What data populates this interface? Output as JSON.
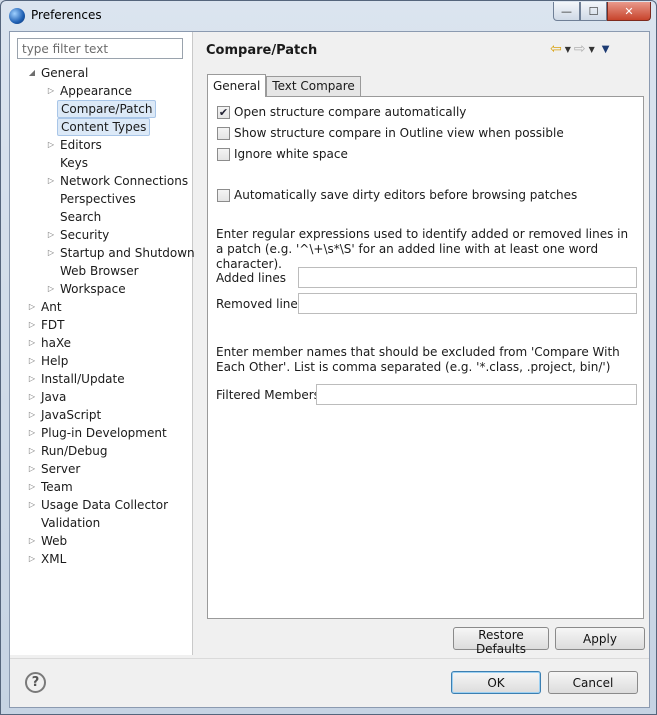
{
  "window": {
    "title": "Preferences"
  },
  "filter": {
    "placeholder": "type filter text"
  },
  "tree": [
    {
      "label": "General",
      "level": 0,
      "expanded": true
    },
    {
      "label": "Appearance",
      "level": 1,
      "expandable": true
    },
    {
      "label": "Compare/Patch",
      "level": 1,
      "selected": true
    },
    {
      "label": "Content Types",
      "level": 1,
      "highlighted": true
    },
    {
      "label": "Editors",
      "level": 1,
      "expandable": true
    },
    {
      "label": "Keys",
      "level": 1
    },
    {
      "label": "Network Connections",
      "level": 1,
      "expandable": true
    },
    {
      "label": "Perspectives",
      "level": 1
    },
    {
      "label": "Search",
      "level": 1
    },
    {
      "label": "Security",
      "level": 1,
      "expandable": true
    },
    {
      "label": "Startup and Shutdown",
      "level": 1,
      "expandable": true
    },
    {
      "label": "Web Browser",
      "level": 1
    },
    {
      "label": "Workspace",
      "level": 1,
      "expandable": true
    },
    {
      "label": "Ant",
      "level": 0,
      "expandable": true
    },
    {
      "label": "FDT",
      "level": 0,
      "expandable": true
    },
    {
      "label": "haXe",
      "level": 0,
      "expandable": true
    },
    {
      "label": "Help",
      "level": 0,
      "expandable": true
    },
    {
      "label": "Install/Update",
      "level": 0,
      "expandable": true
    },
    {
      "label": "Java",
      "level": 0,
      "expandable": true
    },
    {
      "label": "JavaScript",
      "level": 0,
      "expandable": true
    },
    {
      "label": "Plug-in Development",
      "level": 0,
      "expandable": true
    },
    {
      "label": "Run/Debug",
      "level": 0,
      "expandable": true
    },
    {
      "label": "Server",
      "level": 0,
      "expandable": true
    },
    {
      "label": "Team",
      "level": 0,
      "expandable": true
    },
    {
      "label": "Usage Data Collector",
      "level": 0,
      "expandable": true
    },
    {
      "label": "Validation",
      "level": 0
    },
    {
      "label": "Web",
      "level": 0,
      "expandable": true
    },
    {
      "label": "XML",
      "level": 0,
      "expandable": true
    }
  ],
  "page": {
    "title": "Compare/Patch",
    "tabs": [
      "General",
      "Text Compare"
    ],
    "options": [
      {
        "label": "Open structure compare automatically",
        "checked": true
      },
      {
        "label": "Show structure compare in Outline view when possible",
        "checked": false
      },
      {
        "label": "Ignore white space",
        "checked": false
      },
      {
        "label": "Automatically save dirty editors before browsing patches",
        "checked": false
      }
    ],
    "regex_help": "Enter regular expressions used to identify added or removed lines in a patch (e.g. '^\\+\\s*\\S' for an added line with at least one word character).",
    "added_lines_label": "Added lines",
    "added_lines_value": "",
    "removed_lines_label": "Removed lines",
    "removed_lines_value": "",
    "members_help": "Enter member names that should be excluded from 'Compare With Each Other'. List is comma separated (e.g. '*.class, .project, bin/')",
    "filtered_members_label": "Filtered Members:",
    "filtered_members_value": ""
  },
  "buttons": {
    "restore_defaults": "Restore Defaults",
    "apply": "Apply",
    "ok": "OK",
    "cancel": "Cancel",
    "help_glyph": "?"
  },
  "icons": {
    "back": "back-arrow-icon",
    "forward": "forward-arrow-icon",
    "menu": "view-menu-icon",
    "help": "help-icon"
  }
}
